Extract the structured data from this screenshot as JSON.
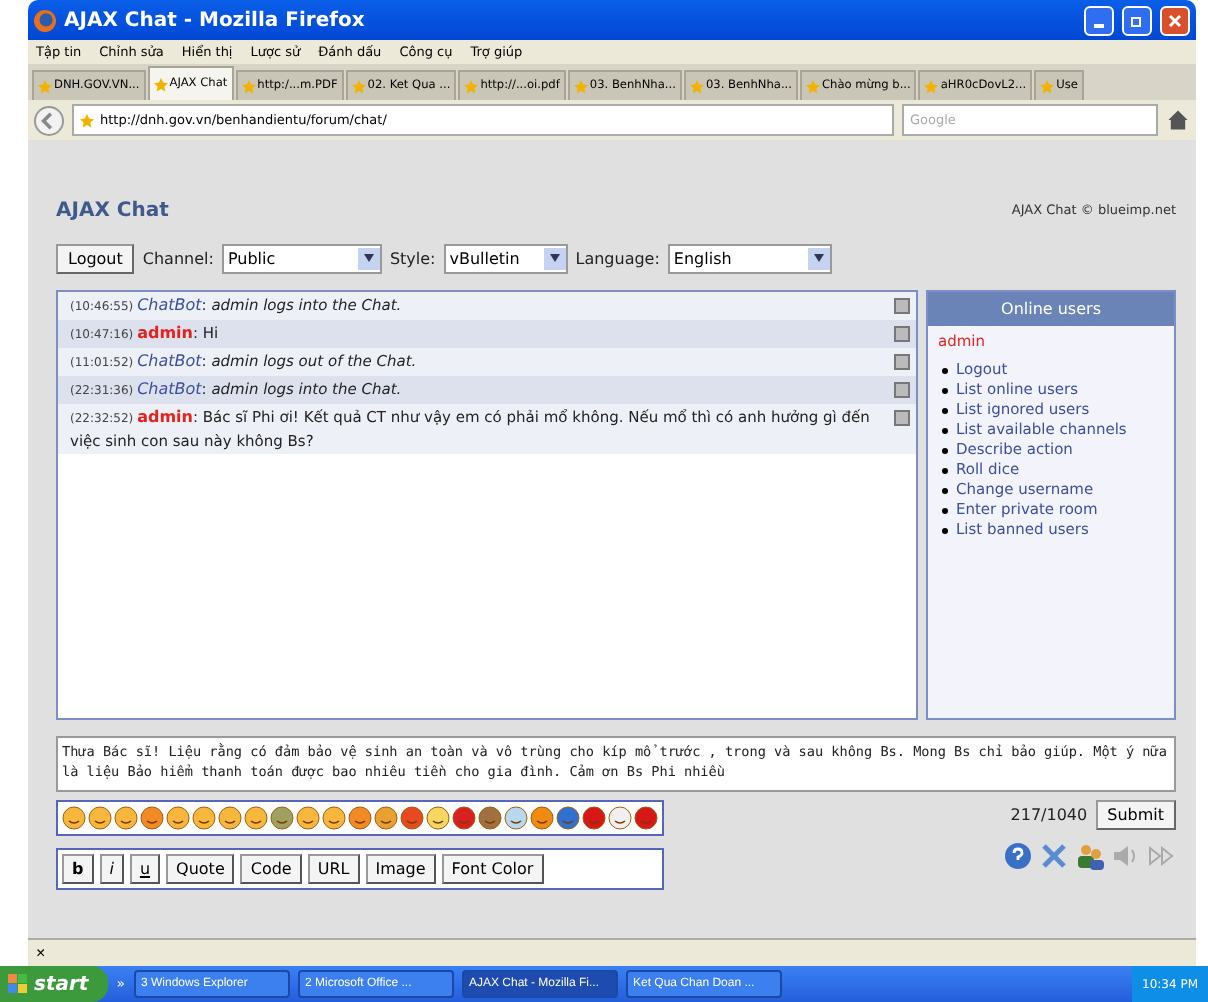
{
  "window": {
    "title": "AJAX Chat - Mozilla Firefox"
  },
  "menu": [
    "Tập tin",
    "Chỉnh sửa",
    "Hiển thị",
    "Lược sử",
    "Đánh dấu",
    "Công cụ",
    "Trợ giúp"
  ],
  "tabs": [
    {
      "label": "DNH.GOV.VN...",
      "selected": false
    },
    {
      "label": "AJAX Chat",
      "selected": true
    },
    {
      "label": "http:/...m.PDF",
      "selected": false
    },
    {
      "label": "02. Ket Qua ...",
      "selected": false
    },
    {
      "label": "http://...oi.pdf",
      "selected": false
    },
    {
      "label": "03. BenhNha...",
      "selected": false
    },
    {
      "label": "03. BenhNha...",
      "selected": false
    },
    {
      "label": "Chào mừng b...",
      "selected": false
    },
    {
      "label": "aHR0cDovL2...",
      "selected": false
    },
    {
      "label": "Use",
      "selected": false
    }
  ],
  "address": "http://dnh.gov.vn/benhandientu/forum/chat/",
  "search": {
    "placeholder": "Google"
  },
  "page": {
    "title": "AJAX Chat",
    "credit": "AJAX Chat © blueimp.net",
    "logout": "Logout",
    "separator": ":",
    "selects": [
      {
        "label": "Channel:",
        "value": "Public"
      },
      {
        "label": "Style:",
        "value": "vBulletin"
      },
      {
        "label": "Language:",
        "value": "English"
      }
    ],
    "messages": [
      {
        "time": "(10:46:55)",
        "user": "ChatBot",
        "kind": "bot",
        "text": "admin logs into the Chat."
      },
      {
        "time": "(10:47:16)",
        "user": "admin",
        "kind": "user",
        "text": "Hi"
      },
      {
        "time": "(11:01:52)",
        "user": "ChatBot",
        "kind": "bot",
        "text": "admin logs out of the Chat."
      },
      {
        "time": "(22:31:36)",
        "user": "ChatBot",
        "kind": "bot",
        "text": "admin logs into the Chat."
      },
      {
        "time": "(22:32:52)",
        "user": "admin",
        "kind": "user",
        "text": "Bác sĩ Phi ơi! Kết quả CT như vậy em có phải mổ không. Nếu mổ thì có anh hưởng gì đến việc sinh con sau này không Bs?"
      }
    ],
    "online": {
      "title": "Online users",
      "user": "admin",
      "commands": [
        "Logout",
        "List online users",
        "List ignored users",
        "List available channels",
        "Describe action",
        "Roll dice",
        "Change username",
        "Enter private room",
        "List banned users"
      ]
    },
    "input": "Thưa Bác sĩ! Liệu rằng có đảm bảo vệ sinh an toàn và vô trùng cho kíp mổ trước , trong và sau không Bs. Mong Bs chỉ bảo giúp. Một ý nữa là liệu Bảo hiểm thanh toán được bao nhiêu tiền cho gia đình. Cảm ơn Bs Phi nhiều",
    "counter": "217/1040",
    "submit": "Submit",
    "format_buttons": [
      {
        "label": "b",
        "kind": "bold"
      },
      {
        "label": "i",
        "kind": "italic"
      },
      {
        "label": "u",
        "kind": "underline"
      },
      {
        "label": "Quote",
        "kind": "plain"
      },
      {
        "label": "Code",
        "kind": "plain"
      },
      {
        "label": "URL",
        "kind": "plain"
      },
      {
        "label": "Image",
        "kind": "plain"
      },
      {
        "label": "Font Color",
        "kind": "plain"
      }
    ]
  },
  "findbar": {
    "close": "×"
  },
  "taskbar": {
    "start": "start",
    "chevron": "»",
    "items": [
      {
        "label": "3 Windows Explorer",
        "selected": false
      },
      {
        "label": "2 Microsoft Office ...",
        "selected": false
      },
      {
        "label": "AJAX Chat - Mozilla Fi...",
        "selected": true
      },
      {
        "label": "Ket Qua Chan Doan ...",
        "selected": false
      }
    ],
    "clock": "10:34 PM"
  }
}
